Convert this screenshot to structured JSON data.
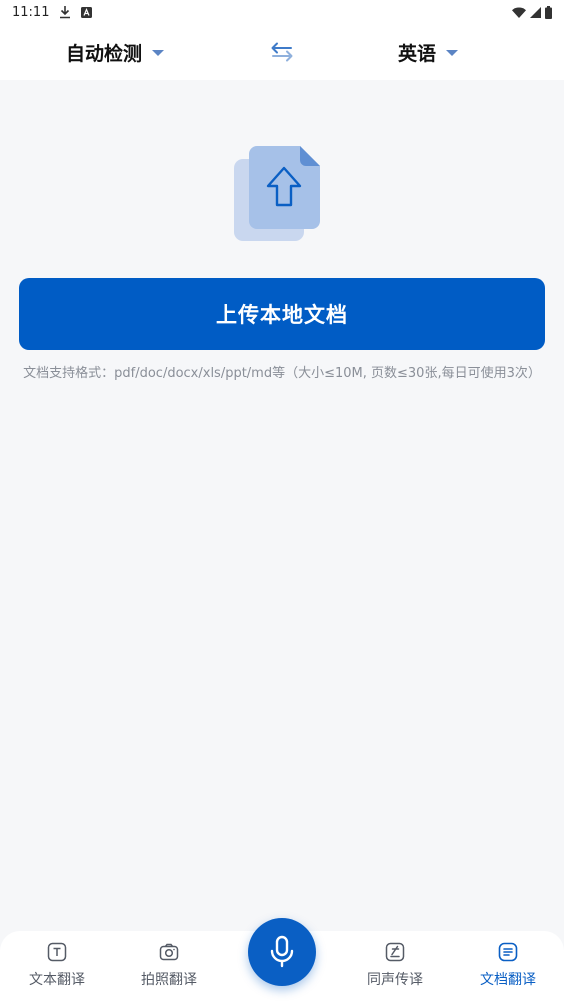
{
  "status_bar": {
    "time": "11:11",
    "icons": [
      "download-icon",
      "a-notification-icon",
      "wifi-icon",
      "signal-icon",
      "battery-icon"
    ]
  },
  "language_bar": {
    "source_language": "自动检测",
    "target_language": "英语",
    "swap_icon": "swap-icon"
  },
  "upload": {
    "illustration": "upload-document-icon",
    "button_label": "上传本地文档",
    "hint": "文档支持格式：pdf/doc/docx/xls/ppt/md等（大小≤10M, 页数≤30张,每日可使用3次）"
  },
  "tabs": [
    {
      "label": "文本翻译",
      "icon": "text-translate-icon",
      "active": false
    },
    {
      "label": "拍照翻译",
      "icon": "camera-icon",
      "active": false
    },
    {
      "label": "同声传译",
      "icon": "simultaneous-icon",
      "active": false
    },
    {
      "label": "文档翻译",
      "icon": "document-icon",
      "active": true
    }
  ],
  "mic": {
    "icon": "microphone-icon"
  },
  "colors": {
    "primary": "#005cc5",
    "accent": "#0a5fc4",
    "background": "#f6f7f9",
    "hint_text": "#8a8f98"
  }
}
